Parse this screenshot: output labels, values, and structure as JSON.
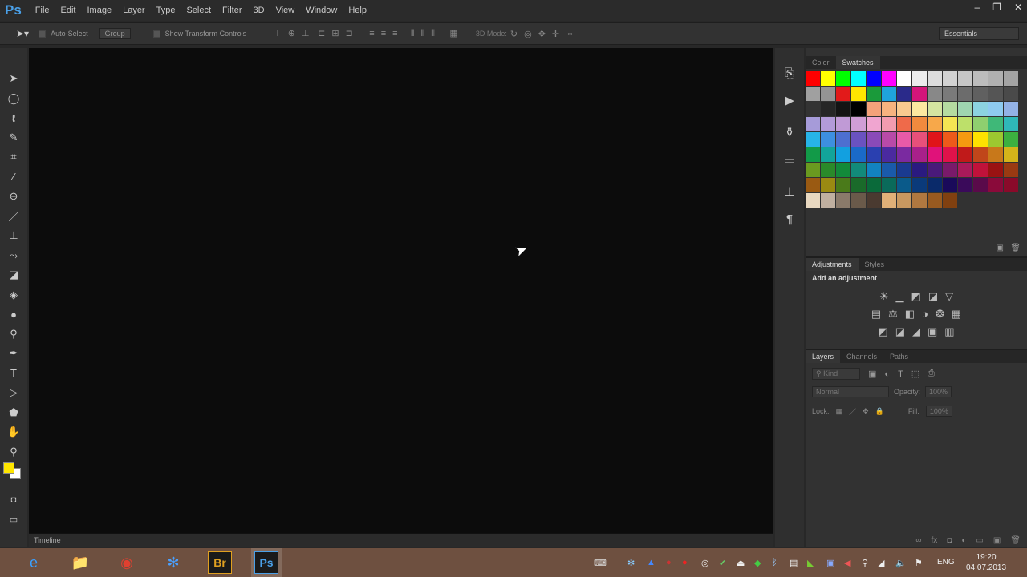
{
  "app": {
    "logo": "Ps",
    "menus": [
      "File",
      "Edit",
      "Image",
      "Layer",
      "Type",
      "Select",
      "Filter",
      "3D",
      "View",
      "Window",
      "Help"
    ],
    "window_controls": [
      "–",
      "❐",
      "✕"
    ]
  },
  "options": {
    "auto_select": "Auto-Select",
    "group": "Group",
    "show_transform": "Show Transform Controls",
    "mode_3d": "3D Mode:",
    "workspace": "Essentials"
  },
  "tools": [
    {
      "n": "move-tool",
      "g": "➤"
    },
    {
      "n": "marquee-tool",
      "g": "◯"
    },
    {
      "n": "lasso-tool",
      "g": "ℓ"
    },
    {
      "n": "quick-select-tool",
      "g": "✎"
    },
    {
      "n": "crop-tool",
      "g": "⌗"
    },
    {
      "n": "eyedropper-tool",
      "g": "⁄"
    },
    {
      "n": "healing-tool",
      "g": "⊖"
    },
    {
      "n": "brush-tool",
      "g": "／"
    },
    {
      "n": "clone-stamp-tool",
      "g": "⊥"
    },
    {
      "n": "history-brush-tool",
      "g": "⤳"
    },
    {
      "n": "eraser-tool",
      "g": "◪"
    },
    {
      "n": "paint-bucket-tool",
      "g": "◈"
    },
    {
      "n": "blur-tool",
      "g": "●"
    },
    {
      "n": "dodge-tool",
      "g": "⚲"
    },
    {
      "n": "pen-tool",
      "g": "✒"
    },
    {
      "n": "type-tool",
      "g": "T"
    },
    {
      "n": "path-select-tool",
      "g": "▷"
    },
    {
      "n": "shape-tool",
      "g": "⬟"
    },
    {
      "n": "hand-tool",
      "g": "✋"
    },
    {
      "n": "zoom-tool",
      "g": "⚲"
    }
  ],
  "colors": {
    "foreground": "#ffe600",
    "background": "#ffffff"
  },
  "timeline": {
    "label": "Timeline"
  },
  "swatches_panel": {
    "tabs": [
      "Color",
      "Swatches"
    ],
    "swatches": [
      "#ff0000",
      "#ffff00",
      "#00ff00",
      "#00ffff",
      "#0000ff",
      "#ff00ff",
      "#ffffff",
      "#ececec",
      "#dcdcdc",
      "#d2d2d2",
      "#c6c6c6",
      "#bcbcbc",
      "#b0b0b0",
      "#a4a4a4",
      "#a0a0a0",
      "#949494",
      "#e21a1a",
      "#ffe600",
      "#1a9a3a",
      "#1fa3dc",
      "#2a2a8a",
      "#d4157a",
      "#888888",
      "#7a7a7a",
      "#6c6c6c",
      "#606060",
      "#555555",
      "#4a4a4a",
      "#333333",
      "#262626",
      "#141414",
      "#000000",
      "#f4a27a",
      "#f6b37f",
      "#f9c98f",
      "#fde8a0",
      "#d4e4a0",
      "#b5dba0",
      "#9fd5b0",
      "#8cd3e0",
      "#8ecbf0",
      "#93b2e6",
      "#a69bd9",
      "#b39bd9",
      "#c09ad6",
      "#d09ed6",
      "#f0a5d0",
      "#f29cb0",
      "#ef6a4a",
      "#f18a3e",
      "#f7a84a",
      "#f4e553",
      "#bde06a",
      "#8fcf6f",
      "#3fb878",
      "#2fb8b8",
      "#27b4e8",
      "#3d8fe0",
      "#4d6fd0",
      "#6a52c0",
      "#8a4ab8",
      "#b84aa8",
      "#e85aa8",
      "#e8507a",
      "#e0141a",
      "#ee5a1a",
      "#f49a10",
      "#fde200",
      "#9cc830",
      "#3cb040",
      "#129a48",
      "#12a49a",
      "#12a0e0",
      "#1a6ac8",
      "#2a40b0",
      "#4a2aa0",
      "#7a2aa0",
      "#a8208a",
      "#e0127a",
      "#e0124a",
      "#c01a1a",
      "#c0461a",
      "#c8781a",
      "#d4b41a",
      "#6a9a20",
      "#2a8a2a",
      "#128a3a",
      "#128a7a",
      "#1282c0",
      "#1a5aaa",
      "#1a3a90",
      "#2a1a80",
      "#4a1a7a",
      "#7a1a6a",
      "#aa1a5a",
      "#c0123a",
      "#9a1212",
      "#9a3a12",
      "#9a5a12",
      "#9a8a12",
      "#4a7a1a",
      "#1a6a2a",
      "#0a6a3a",
      "#0a6a5a",
      "#0a5a8a",
      "#0a3a7a",
      "#0a2a6a",
      "#1a0a5a",
      "#3a0a5a",
      "#5a0a4a",
      "#8a0a3a",
      "#8a0a2a",
      "#e8d8c0",
      "#c0b0a0",
      "#8a7a6a",
      "#6a5a4a",
      "#4a3a30",
      "#e0b078",
      "#c89860",
      "#b07840",
      "#985a20",
      "#804010"
    ]
  },
  "adjustments_panel": {
    "tabs": [
      "Adjustments",
      "Styles"
    ],
    "heading": "Add an adjustment"
  },
  "layers_panel": {
    "tabs": [
      "Layers",
      "Channels",
      "Paths"
    ],
    "filter": "Kind",
    "blend_mode": "Normal",
    "opacity_label": "Opacity:",
    "opacity": "100%",
    "lock_label": "Lock:",
    "fill_label": "Fill:",
    "fill": "100%"
  },
  "taskbar": {
    "apps": [
      {
        "n": "internet-explorer",
        "g": "e",
        "c": "#3aa0ff"
      },
      {
        "n": "file-explorer",
        "g": "📁",
        "c": "#f0c040"
      },
      {
        "n": "chrome",
        "g": "◉",
        "c": "#e04030"
      },
      {
        "n": "app-flower",
        "g": "✻",
        "c": "#4aa0ff"
      },
      {
        "n": "bridge",
        "g": "Br",
        "c": "#e0a020"
      },
      {
        "n": "photoshop",
        "g": "Ps",
        "c": "#4aa0e8"
      }
    ],
    "lang": "ENG",
    "time": "19:20",
    "date": "04.07.2013"
  }
}
